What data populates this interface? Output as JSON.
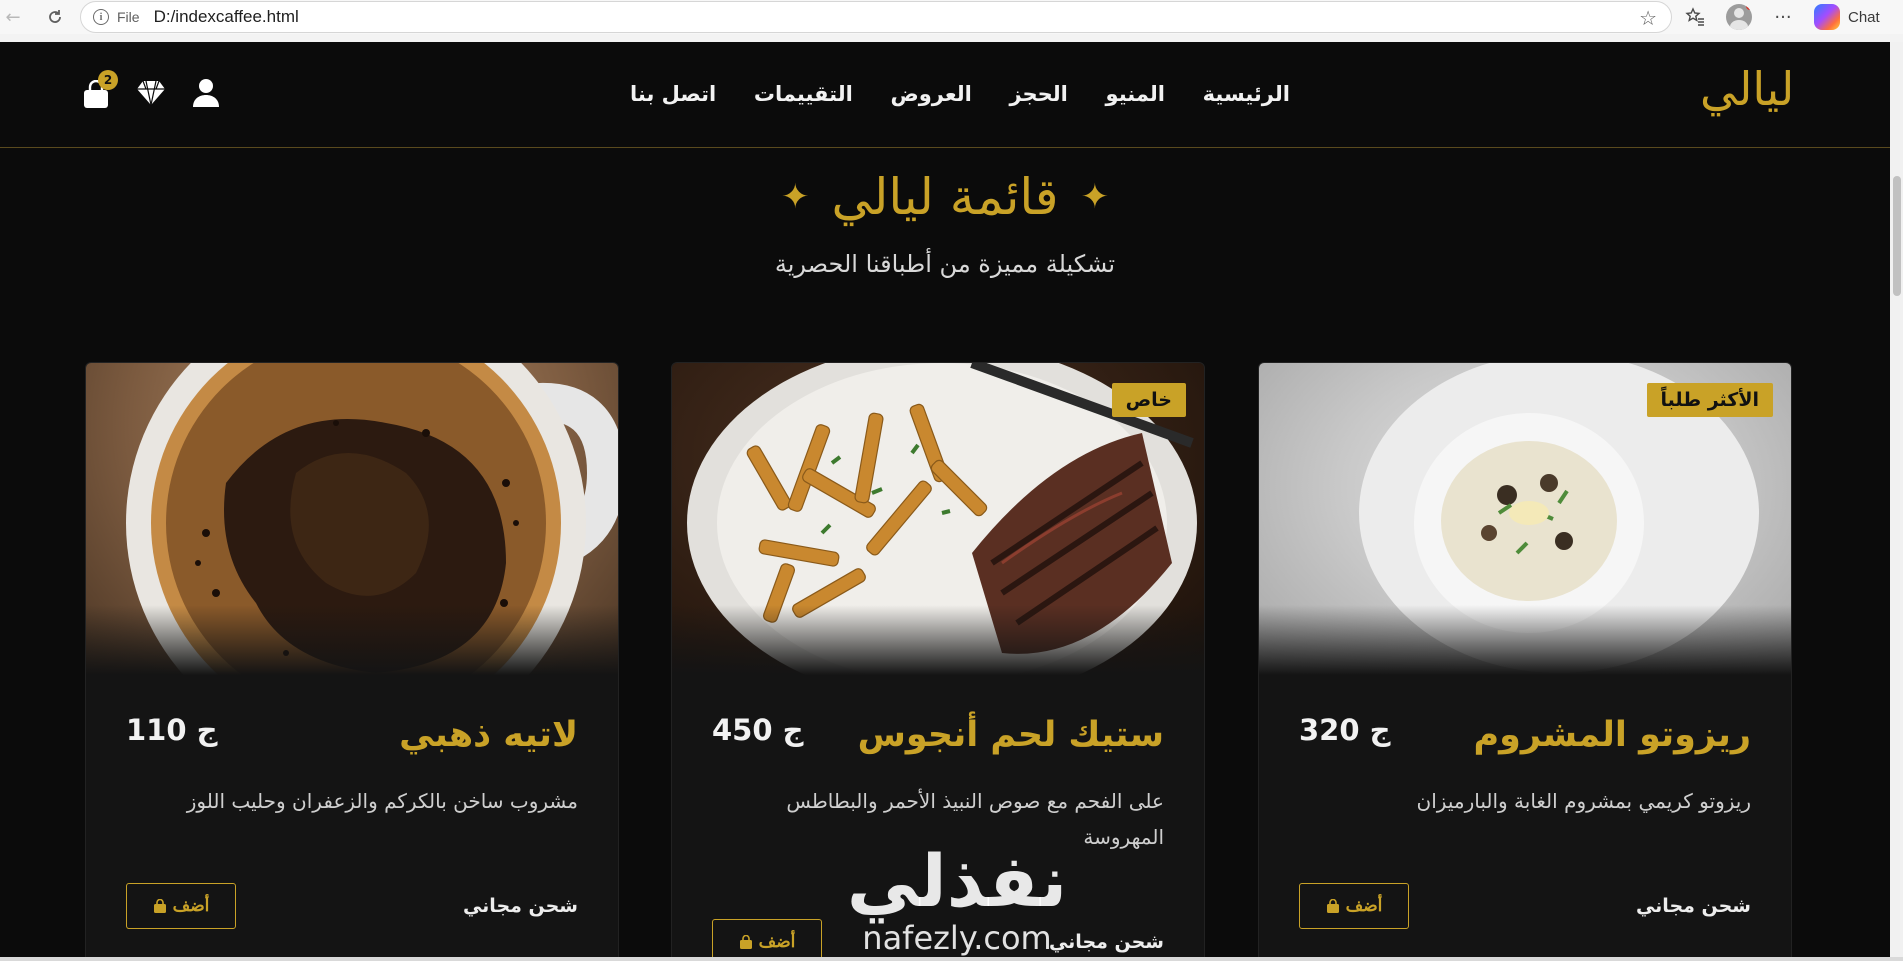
{
  "browser": {
    "file_label": "File",
    "url": "D:/indexcaffee.html",
    "chat_label": "Chat"
  },
  "header": {
    "brand": "ليالي",
    "nav": [
      "الرئيسية",
      "المنيو",
      "الحجز",
      "العروض",
      "التقييمات",
      "اتصل بنا"
    ],
    "cart_count": "2",
    "icons": [
      "user-icon",
      "diamond-icon",
      "shopping-bag-icon"
    ]
  },
  "menu": {
    "title": "قائمة ليالي",
    "sparkle": "✦",
    "subtitle": "تشكيلة مميزة من أطباقنا الحصرية"
  },
  "cards": [
    {
      "tag": "الأكثر طلباً",
      "name": "ريزوتو المشروم",
      "price": "320 ج",
      "description": "ريزوتو كريمي بمشروم الغابة والبارميزان",
      "shipping": "شحن مجاني",
      "add_label": "أضف",
      "image": "risotto-image"
    },
    {
      "tag": "خاص",
      "name": "ستيك لحم أنجوس",
      "price": "450 ج",
      "description": "على الفحم مع صوص النبيذ الأحمر والبطاطس المهروسة",
      "shipping": "شحن مجاني",
      "add_label": "أضف",
      "image": "steak-image"
    },
    {
      "tag": "",
      "name": "لاتيه ذهبي",
      "price": "110 ج",
      "description": "مشروب ساخن بالكركم والزعفران وحليب اللوز",
      "shipping": "شحن مجاني",
      "add_label": "أضف",
      "image": "coffee-image"
    }
  ],
  "watermark": {
    "arabic": "نفذلي",
    "latin": "nafezly.com"
  },
  "colors": {
    "gold": "#c9a227",
    "background": "#0b0b0b",
    "card": "#141414"
  }
}
